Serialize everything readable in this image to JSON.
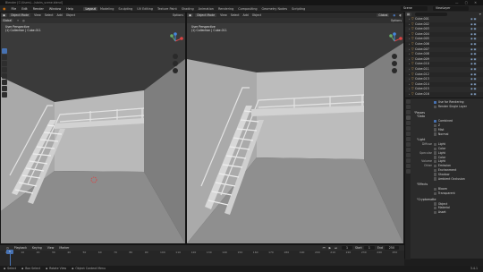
{
  "window": {
    "title": "Blender [C:\\Users\\...\\stairs_scene.blend]",
    "controls": "— ▢ ✕"
  },
  "menu": {
    "items": [
      "File",
      "Edit",
      "Render",
      "Window",
      "Help"
    ],
    "workspaces": [
      "Layout",
      "Modeling",
      "Sculpting",
      "UV Editing",
      "Texture Paint",
      "Shading",
      "Animation",
      "Rendering",
      "Compositing",
      "Geometry Nodes",
      "Scripting"
    ],
    "active_workspace": "Layout",
    "scene": "Scene",
    "view_layer": "ViewLayer"
  },
  "viewport_left": {
    "mode": "Object Mode",
    "menus": [
      "View",
      "Select",
      "Add",
      "Object"
    ],
    "transform": "Global",
    "info_line1": "User Perspective",
    "info_line2": "(1) Collection | Cube.011",
    "options": "Options"
  },
  "viewport_right": {
    "mode": "Object Mode",
    "menus": [
      "View",
      "Select",
      "Add",
      "Object"
    ],
    "transform": "Global",
    "info_line1": "User Perspective",
    "info_line2": "(1) Collection | Cube.011",
    "options": "Options"
  },
  "outliner": {
    "filter_placeholder": "",
    "items": [
      "Cube.001",
      "Cube.002",
      "Cube.003",
      "Cube.004",
      "Cube.005",
      "Cube.006",
      "Cube.007",
      "Cube.008",
      "Cube.009",
      "Cube.010",
      "Cube.011",
      "Cube.012",
      "Cube.013",
      "Cube.014",
      "Cube.015",
      "Cube.016"
    ]
  },
  "properties": {
    "top_items": [
      "Use for Rendering",
      "Render Single Layer"
    ],
    "sections": {
      "passes": "Passes",
      "data": "Data",
      "data_items": [
        "Combined",
        "Z",
        "Mist",
        "Normal"
      ],
      "light": "Light",
      "light_rows": [
        {
          "label": "Diffuse",
          "items": [
            "Light",
            "Color"
          ]
        },
        {
          "label": "Specular",
          "items": [
            "Light",
            "Color"
          ]
        },
        {
          "label": "Volume",
          "items": [
            "Light"
          ]
        },
        {
          "label": "Other",
          "items": [
            "Emission",
            "Environment",
            "Shadow",
            "Ambient Occlusion"
          ]
        }
      ],
      "effects": "Effects",
      "effects_items": [
        "Bloom",
        "Transparent"
      ],
      "cryptomatte": "Cryptomatte",
      "crypto_items": [
        "Object",
        "Material",
        "Asset"
      ]
    }
  },
  "timeline": {
    "menus": [
      "Playback",
      "Keying",
      "View",
      "Marker"
    ],
    "ticks": [
      "0",
      "10",
      "20",
      "30",
      "40",
      "50",
      "60",
      "70",
      "80",
      "90",
      "100",
      "110",
      "120",
      "130",
      "140",
      "150",
      "160",
      "170",
      "180",
      "190",
      "200",
      "210",
      "220",
      "230",
      "240",
      "250"
    ],
    "frame_current": "1",
    "start_label": "Start",
    "start": "1",
    "end_label": "End",
    "end": "250"
  },
  "statusbar": {
    "select": "Select",
    "box_select": "Box Select",
    "rotate_view": "Rotate View",
    "context_menu": "Object Context Menu",
    "version": "3.4.1"
  },
  "colors": {
    "accent": "#4772b3",
    "object_orange": "#e1a64d",
    "viewport_bg": "#3c3c3c"
  }
}
